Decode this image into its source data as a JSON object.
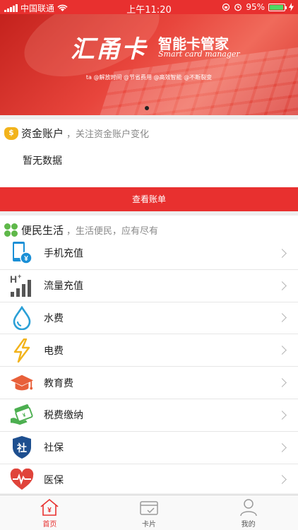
{
  "status_bar": {
    "carrier": "中国联通",
    "time": "上午11:20",
    "battery_percent": "95%",
    "battery_level": 0.95
  },
  "banner": {
    "logo_text": "汇甬卡",
    "title": "智能卡管家",
    "subtitle": "Smart card manager",
    "tagline": "ta @解放时间 @节省费用 @高效智能 @不断裂变",
    "page_indicator": {
      "count": 1,
      "active": 1
    }
  },
  "fund_account": {
    "title": "资金账户",
    "subtitle": "，关注资金账户变化",
    "empty_text": "暂无数据",
    "button_label": "查看账单"
  },
  "life_services": {
    "title": "便民生活",
    "subtitle": "，生活便民，应有尽有",
    "items": [
      {
        "label": "手机充值",
        "icon": "phone-recharge-icon"
      },
      {
        "label": "流量充值",
        "icon": "data-recharge-icon"
      },
      {
        "label": "水费",
        "icon": "water-drop-icon"
      },
      {
        "label": "电费",
        "icon": "lightning-icon"
      },
      {
        "label": "教育费",
        "icon": "graduation-cap-icon"
      },
      {
        "label": "税费缴纳",
        "icon": "tax-payment-icon"
      },
      {
        "label": "社保",
        "icon": "social-security-shield-icon",
        "glyph": "社"
      },
      {
        "label": "医保",
        "icon": "medical-heart-icon"
      }
    ]
  },
  "tab_bar": {
    "tabs": [
      {
        "label": "首页",
        "icon": "home-icon",
        "active": true
      },
      {
        "label": "卡片",
        "icon": "card-icon",
        "active": false
      },
      {
        "label": "我的",
        "icon": "user-icon",
        "active": false
      }
    ]
  },
  "colors": {
    "brand_red": "#e8302f",
    "gold": "#f2b31b",
    "green": "#5fb84a",
    "blue": "#1a8fd6",
    "inactive_gray": "#9a9a9a"
  }
}
